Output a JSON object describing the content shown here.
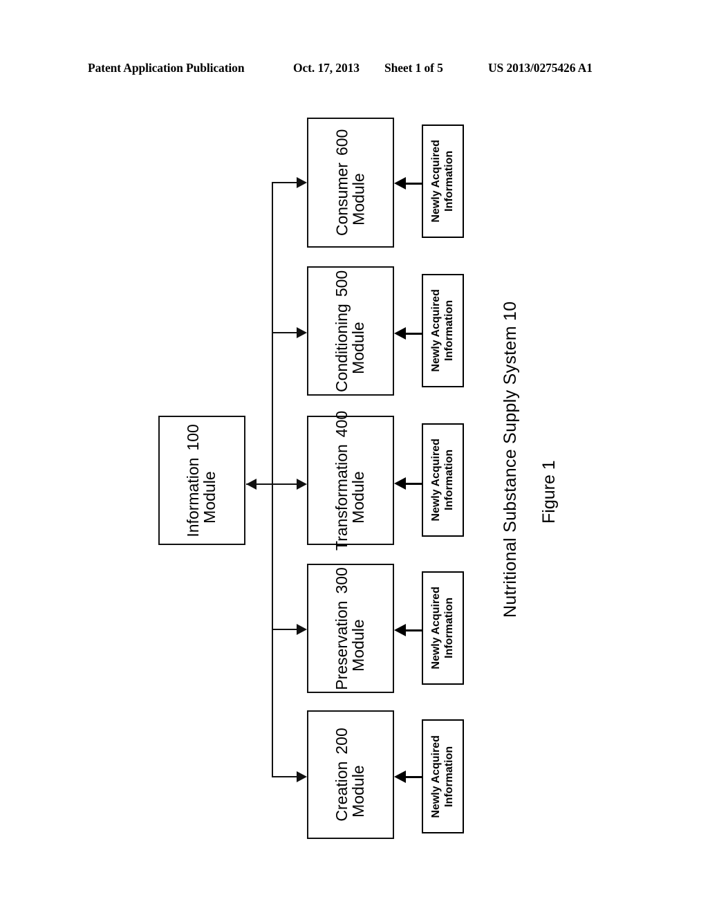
{
  "header": {
    "publication": "Patent Application Publication",
    "date": "Oct. 17, 2013",
    "sheet": "Sheet 1 of 5",
    "patent_number": "US 2013/0275426 A1"
  },
  "caption": {
    "system_title": "Nutritional Substance Supply System  10",
    "figure_label": "Figure 1"
  },
  "diagram": {
    "information_module": {
      "name_line1": "Information",
      "name_line2": "Module",
      "reference": "100"
    },
    "modules": [
      {
        "name_line1": "Consumer",
        "name_line2": "Module",
        "reference": "600",
        "input_line1": "Newly Acquired",
        "input_line2": "Information"
      },
      {
        "name_line1": "Conditioning",
        "name_line2": "Module",
        "reference": "500",
        "input_line1": "Newly Acquired",
        "input_line2": "Information"
      },
      {
        "name_line1": "Transformation",
        "name_line2": "Module",
        "reference": "400",
        "input_line1": "Newly Acquired",
        "input_line2": "Information"
      },
      {
        "name_line1": "Preservation",
        "name_line2": "Module",
        "reference": "300",
        "input_line1": "Newly Acquired",
        "input_line2": "Information"
      },
      {
        "name_line1": "Creation",
        "name_line2": "Module",
        "reference": "200",
        "input_line1": "Newly Acquired",
        "input_line2": "Information"
      }
    ]
  }
}
